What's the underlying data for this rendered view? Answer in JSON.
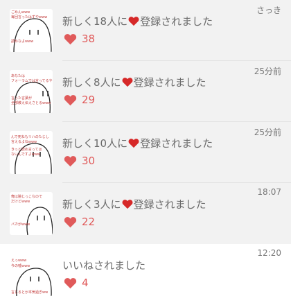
{
  "colors": {
    "heart": "#e05a5a",
    "title_heart": "#d62828",
    "text": "#6b6b6b"
  },
  "notifications": [
    {
      "title_before": "新しく18人に",
      "title_after": "登録されました",
      "likes": "38",
      "time": "さっき",
      "thumbnail_text": [
        "ごめんwww",
        "毎回言ったはずやwww",
        "読めなよwww"
      ]
    },
    {
      "title_before": "新しく8人に",
      "title_after": "登録されました",
      "likes": "29",
      "time": "25分前",
      "thumbnail_text": [
        "あなたは",
        "フォーラムでは言ってるや",
        "言った言葉が",
        "全部教え伝えさとるwww"
      ]
    },
    {
      "title_before": "新しく10人に",
      "title_after": "登録されました",
      "likes": "30",
      "time": "25分前",
      "thumbnail_text": [
        "んで死ねもリハのたじし",
        "言えるよねwww",
        "きっと読め言っては",
        "ないんですよwww"
      ]
    },
    {
      "title_before": "新しく3人に",
      "title_after": "登録されました",
      "likes": "22",
      "time": "18:07",
      "thumbnail_text": [
        "俺は臆じっこなので",
        "だけどwww",
        "バカがwww"
      ]
    },
    {
      "title_before": "いいねされました",
      "title_after": "",
      "likes": "4",
      "time": "12:20",
      "thumbnail_text": [
        "えっwww",
        "今の嘘www",
        "言じるとか本気過ぎww"
      ]
    }
  ]
}
